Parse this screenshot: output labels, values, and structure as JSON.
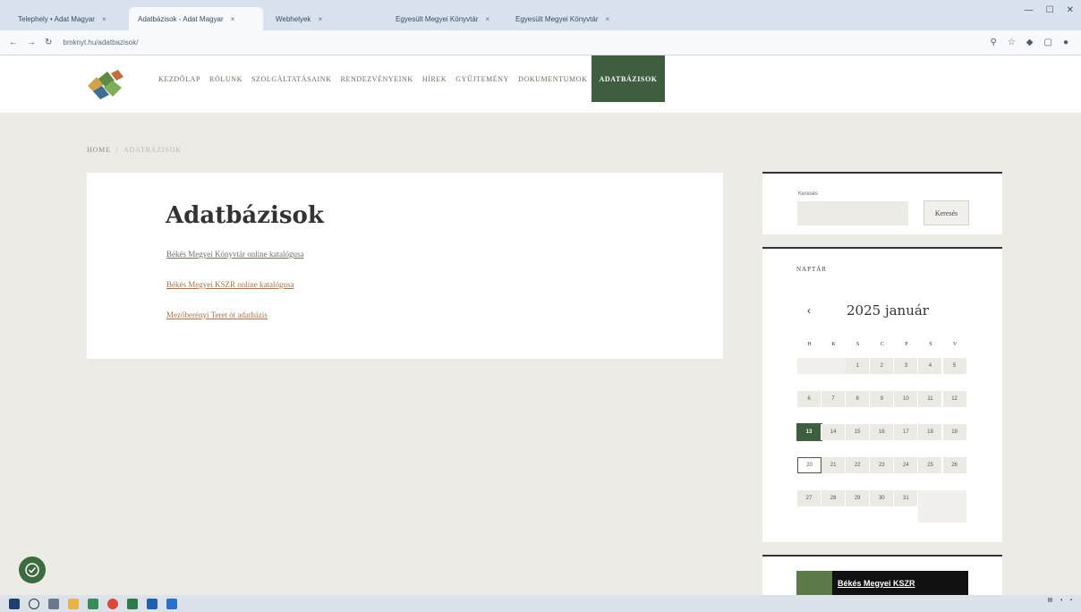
{
  "browser": {
    "tabs": [
      {
        "label": "Telephely • Adat Magyar",
        "active": false
      },
      {
        "label": "Adatbázisok - Adat Magyar",
        "active": true
      },
      {
        "label": "Webhelyek",
        "active": false
      },
      {
        "label": "Egyesült Megyei Könyvtár",
        "active": false
      },
      {
        "label": "Egyesült Megyei Könyvtár",
        "active": false
      }
    ],
    "url": "bmknyt.hu/adatbazisok/"
  },
  "menu": {
    "items": [
      "KEZDŐLAP",
      "RÓLUNK",
      "SZOLGÁLTATÁSAINK",
      "RENDEZVÉNYEINK",
      "HÍREK",
      "GYŰJTEMÉNY",
      "DOKUMENTUMOK",
      "ADATBÁZISOK"
    ],
    "active_index": 7,
    "active_color": "#3f5e3f"
  },
  "breadcrumb": {
    "home": "HOME",
    "separator": "/",
    "current": "ADATBÁZISOK"
  },
  "content": {
    "title": "Adatbázisok",
    "links": [
      "Békés Megyei Könyvtár online katalógusa",
      "Békés Megyei KSZR online katalógusa",
      "Mezőberényi Teret ót adatbázis"
    ],
    "link_color": "#a5744a"
  },
  "search": {
    "label": "Keresés",
    "button_label": "Keresés",
    "placeholder": ""
  },
  "calendar": {
    "widget_title": "NAPTÁR",
    "prev_label": "‹",
    "month_label": "2025 január",
    "weekdays": [
      "H",
      "K",
      "S",
      "C",
      "P",
      "S",
      "V"
    ],
    "weeks": [
      [
        "",
        "",
        "1",
        "2",
        "3",
        "4",
        "5"
      ],
      [
        "6",
        "7",
        "8",
        "9",
        "10",
        "11",
        "12"
      ],
      [
        "13",
        "14",
        "15",
        "16",
        "17",
        "18",
        "19"
      ],
      [
        "20",
        "21",
        "22",
        "23",
        "24",
        "25",
        "26"
      ],
      [
        "27",
        "28",
        "29",
        "30",
        "31",
        "",
        ""
      ]
    ],
    "today": "13",
    "selected": "20"
  },
  "banner": {
    "label": "Békés Megyei KSZR"
  }
}
